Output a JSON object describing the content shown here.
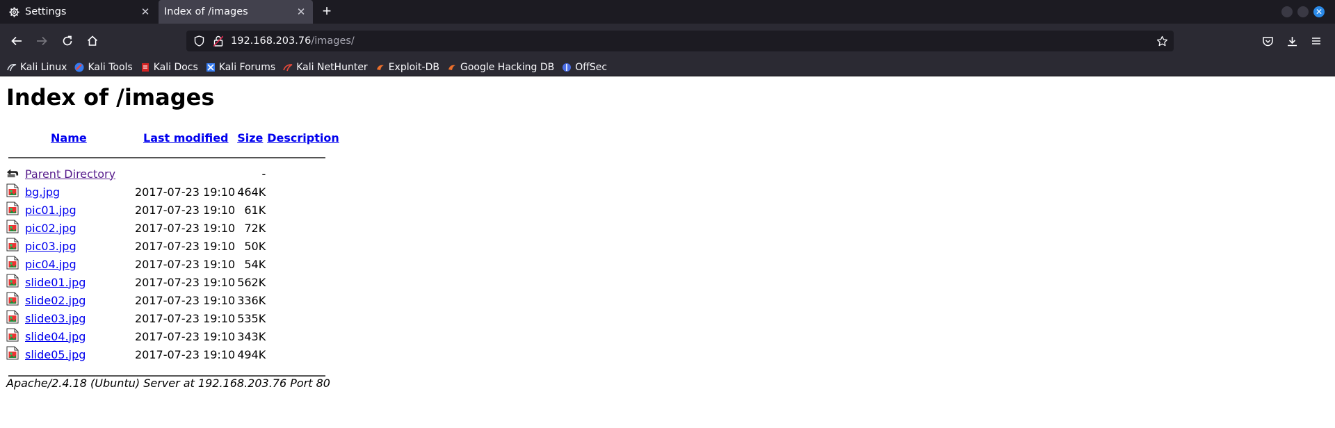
{
  "tabs": [
    {
      "label": "Settings",
      "icon": "gear-icon"
    },
    {
      "label": "Index of /images",
      "icon": ""
    }
  ],
  "url": {
    "host": "192.168.203.76",
    "path": "/images/"
  },
  "bookmarks": [
    {
      "label": "Kali Linux",
      "icon": "kali-dragon-icon"
    },
    {
      "label": "Kali Tools",
      "icon": "kali-tools-icon"
    },
    {
      "label": "Kali Docs",
      "icon": "kali-docs-icon"
    },
    {
      "label": "Kali Forums",
      "icon": "kali-forums-icon"
    },
    {
      "label": "Kali NetHunter",
      "icon": "nethunter-icon"
    },
    {
      "label": "Exploit-DB",
      "icon": "exploit-db-icon"
    },
    {
      "label": "Google Hacking DB",
      "icon": "ghdb-icon"
    },
    {
      "label": "OffSec",
      "icon": "offsec-icon"
    }
  ],
  "page": {
    "title": "Index of /images",
    "columns": {
      "name": "Name",
      "modified": "Last modified",
      "size": "Size",
      "description": "Description"
    },
    "parent": {
      "name": "Parent Directory",
      "size": "-"
    },
    "files": [
      {
        "name": "bg.jpg",
        "modified": "2017-07-23 19:10",
        "size": "464K"
      },
      {
        "name": "pic01.jpg",
        "modified": "2017-07-23 19:10",
        "size": "61K"
      },
      {
        "name": "pic02.jpg",
        "modified": "2017-07-23 19:10",
        "size": "72K"
      },
      {
        "name": "pic03.jpg",
        "modified": "2017-07-23 19:10",
        "size": "50K"
      },
      {
        "name": "pic04.jpg",
        "modified": "2017-07-23 19:10",
        "size": "54K"
      },
      {
        "name": "slide01.jpg",
        "modified": "2017-07-23 19:10",
        "size": "562K"
      },
      {
        "name": "slide02.jpg",
        "modified": "2017-07-23 19:10",
        "size": "336K"
      },
      {
        "name": "slide03.jpg",
        "modified": "2017-07-23 19:10",
        "size": "535K"
      },
      {
        "name": "slide04.jpg",
        "modified": "2017-07-23 19:10",
        "size": "343K"
      },
      {
        "name": "slide05.jpg",
        "modified": "2017-07-23 19:10",
        "size": "494K"
      }
    ],
    "footer": "Apache/2.4.18 (Ubuntu) Server at 192.168.203.76 Port 80"
  },
  "colors": {
    "link": "#0000ee",
    "visited": "#551a8b",
    "chrome_dark": "#1c1b22",
    "chrome": "#2b2a33",
    "active_tab": "#42414d"
  }
}
